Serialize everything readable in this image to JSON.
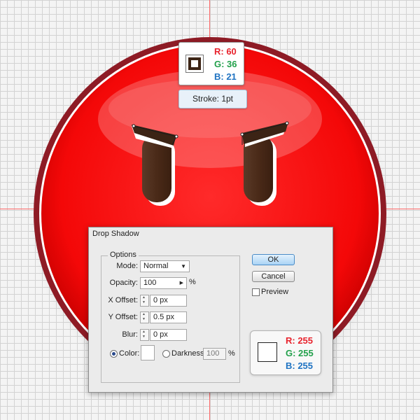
{
  "stroke_swatch": {
    "r_label": "R: 60",
    "g_label": "G: 36",
    "b_label": "B: 21",
    "color": "#3c2415",
    "tooltip": "Stroke: 1pt"
  },
  "dialog": {
    "title": "Drop Shadow",
    "options_legend": "Options",
    "mode_label": "Mode:",
    "mode_value": "Normal",
    "opacity_label": "Opacity:",
    "opacity_value": "100",
    "opacity_unit": "%",
    "xoffset_label": "X Offset:",
    "xoffset_value": "0 px",
    "yoffset_label": "Y Offset:",
    "yoffset_value": "0.5 px",
    "blur_label": "Blur:",
    "blur_value": "0 px",
    "color_label": "Color:",
    "darkness_label": "Darkness:",
    "darkness_value": "100",
    "darkness_unit": "%",
    "ok_label": "OK",
    "cancel_label": "Cancel",
    "preview_label": "Preview"
  },
  "color_swatch": {
    "r_label": "R: 255",
    "g_label": "G: 255",
    "b_label": "B: 255",
    "color": "#ffffff"
  },
  "colors": {
    "face_red": "#ff1a1a",
    "face_rim": "#8e1b25",
    "eye_brown": "#4a2a18",
    "guide": "#ff6a6a",
    "grid": "#d3d3d3"
  }
}
